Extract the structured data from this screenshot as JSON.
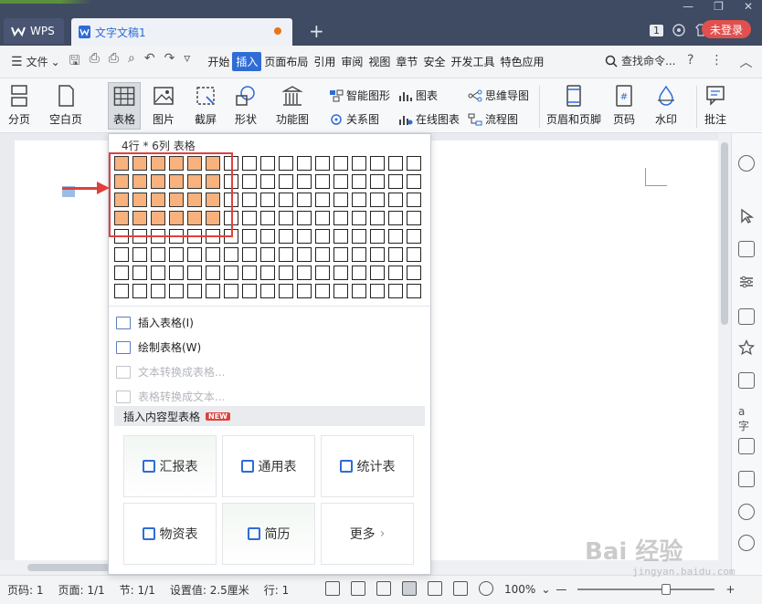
{
  "titlebar": {
    "wps_tab": "WPS",
    "doc_tab": "文字文稿1",
    "badge": "1",
    "login": "未登录"
  },
  "menubar": {
    "file": "文件",
    "items": [
      "开始",
      "插入",
      "页面布局",
      "引用",
      "审阅",
      "视图",
      "章节",
      "安全",
      "开发工具",
      "特色应用"
    ],
    "active": "插入",
    "search": "查找命令..."
  },
  "ribbon": {
    "buttons": [
      {
        "label": "分页"
      },
      {
        "label": "空白页"
      },
      {
        "label": "表格"
      },
      {
        "label": "图片"
      },
      {
        "label": "截屏"
      },
      {
        "label": "形状"
      },
      {
        "label": "功能图"
      }
    ],
    "small": {
      "smart_shape": "智能图形",
      "relation": "关系图",
      "chart": "图表",
      "online_chart": "在线图表",
      "mindmap": "思维导图",
      "flowchart": "流程图"
    },
    "right_buttons": [
      {
        "label": "页眉和页脚"
      },
      {
        "label": "页码"
      },
      {
        "label": "水印"
      },
      {
        "label": "批注"
      }
    ]
  },
  "table_panel": {
    "title": "4行 * 6列 表格",
    "selected_rows": 4,
    "selected_cols": 6,
    "menu": [
      {
        "label": "插入表格(I)",
        "enabled": true
      },
      {
        "label": "绘制表格(W)",
        "enabled": true
      },
      {
        "label": "文本转换成表格...",
        "enabled": false
      },
      {
        "label": "表格转换成文本...",
        "enabled": false
      }
    ],
    "section": "插入内容型表格",
    "new_badge": "NEW",
    "cards": [
      "汇报表",
      "通用表",
      "统计表",
      "物资表",
      "简历",
      "更多"
    ]
  },
  "statusbar": {
    "page_no": "页码: 1",
    "pages": "页面: 1/1",
    "section": "节: 1/1",
    "setting": "设置值: 2.5厘米",
    "row": "行: 1",
    "zoom": "100%"
  },
  "watermark": {
    "main": "Bai 经验",
    "sub": "jingyan.baidu.com"
  }
}
